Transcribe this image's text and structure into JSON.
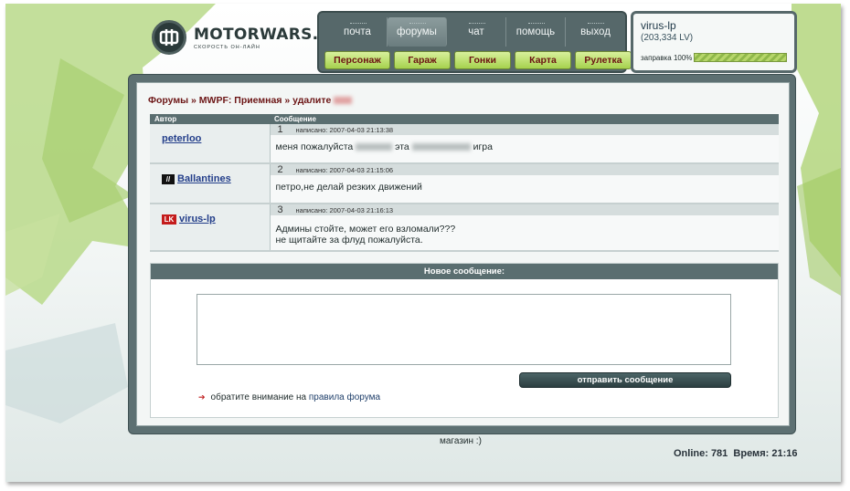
{
  "logo": {
    "title": "MOTORWARS.RU",
    "subtitle": "СКОРОСТЬ ОН-ЛАЙН"
  },
  "nav": {
    "top": [
      {
        "label": "почта",
        "active": false
      },
      {
        "label": "форумы",
        "active": true
      },
      {
        "label": "чат",
        "active": false
      },
      {
        "label": "помощь",
        "active": false
      },
      {
        "label": "выход",
        "active": false
      }
    ],
    "bottom": [
      "Персонаж",
      "Гараж",
      "Гонки",
      "Карта",
      "Рулетка"
    ]
  },
  "user": {
    "name": "virus-lp",
    "level": "(203,334 LV)",
    "fuel_label": "заправка 100%",
    "fuel_percent": 100
  },
  "breadcrumb": {
    "forums": "Форумы",
    "sep1": " » ",
    "section": "MWPF: Приемная",
    "sep2": " » ",
    "topic": "удалите "
  },
  "table": {
    "headers": {
      "author": "Автор",
      "message": "Сообщение"
    },
    "posts": [
      {
        "num": "1",
        "author": "peterloo",
        "date": "написано: 2007-04-03 21:13:38",
        "text_a": "меня пожалуйста ",
        "text_b": " эта ",
        "text_c": " игра",
        "lines": []
      },
      {
        "num": "2",
        "author": "Ballantines",
        "date": "написано: 2007-04-03 21:15:06",
        "text": "петро,не делай резких движений"
      },
      {
        "num": "3",
        "author": "virus-lp",
        "date": "написано: 2007-04-03 21:16:13",
        "line1": "Админы стойте, может его взломали???",
        "line2": "не щитайте за флуд пожалуйста."
      }
    ]
  },
  "new_message": {
    "title": "Новое сообщение:",
    "send": "отправить сообщение",
    "notice": "обратите внимание на ",
    "notice_link": "правила форума"
  },
  "footer": {
    "shop": "магазин :)",
    "online": "Online: 781",
    "time": "Время: 21:16"
  },
  "colors": {
    "accent_green": "#a6d24e",
    "panel_gray": "#56686a",
    "link_blue": "#233e8a",
    "crumb_red": "#6c1616"
  }
}
